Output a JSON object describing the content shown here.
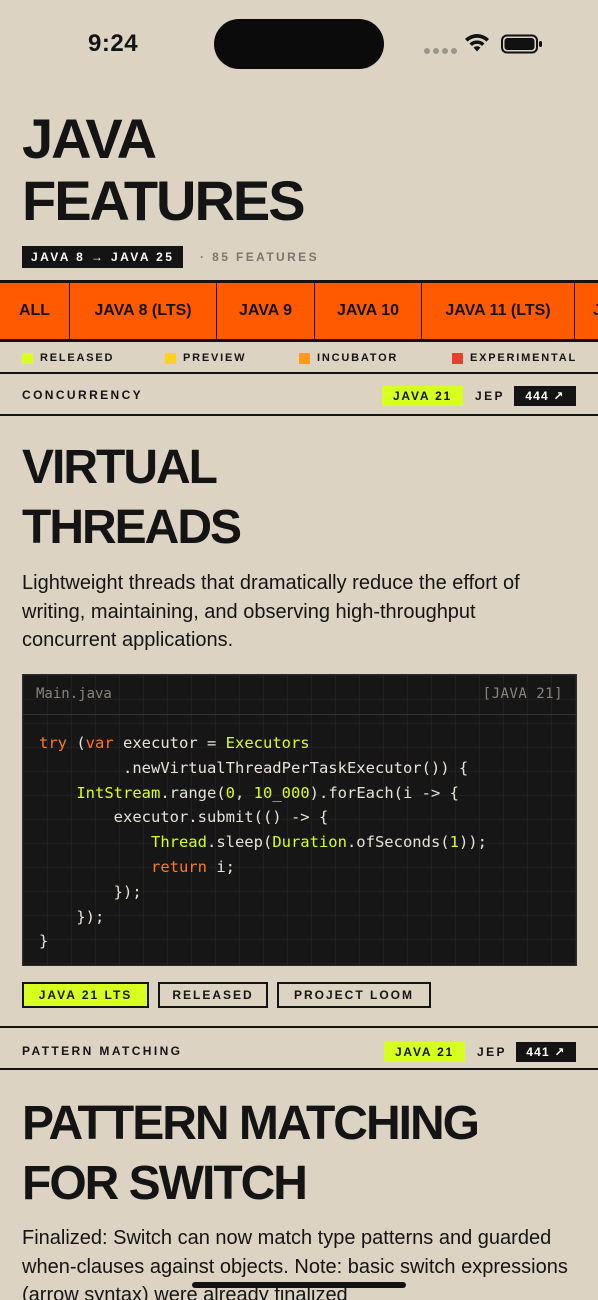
{
  "status": {
    "time": "9:24"
  },
  "header": {
    "title_line1": "JAVA",
    "title_line2": "FEATURES",
    "version_range": "JAVA 8 → JAVA 25",
    "feature_count": "· 85 FEATURES"
  },
  "tabs": [
    {
      "label": "ALL"
    },
    {
      "label": "JAVA 8 (LTS)"
    },
    {
      "label": "JAVA 9"
    },
    {
      "label": "JAVA 10"
    },
    {
      "label": "JAVA 11 (LTS)"
    },
    {
      "label": "J"
    }
  ],
  "legend": [
    {
      "label": "RELEASED",
      "color": "#d7ff1f"
    },
    {
      "label": "PREVIEW",
      "color": "#ffd21f"
    },
    {
      "label": "INCUBATOR",
      "color": "#ff9a1f"
    },
    {
      "label": "EXPERIMENTAL",
      "color": "#e8412b"
    }
  ],
  "features": [
    {
      "category": "CONCURRENCY",
      "java_version": "JAVA 21",
      "jep_label": "JEP",
      "jep_number": "444 ↗",
      "title_line1": "VIRTUAL",
      "title_line2": "THREADS",
      "description": "Lightweight threads that dramatically reduce the effort of writing, maintaining, and observing high-throughput concurrent applications.",
      "code": {
        "filename": "Main.java",
        "version_label": "[JAVA 21]"
      },
      "tags": [
        "JAVA 21 LTS",
        "RELEASED",
        "PROJECT LOOM"
      ]
    },
    {
      "category": "PATTERN MATCHING",
      "java_version": "JAVA 21",
      "jep_label": "JEP",
      "jep_number": "441 ↗",
      "title_line1": "PATTERN MATCHING",
      "title_line2": "FOR SWITCH",
      "description": "Finalized: Switch can now match type patterns and guarded when-clauses against objects. Note: basic switch expressions (arrow syntax) were already finalized"
    }
  ],
  "colors": {
    "background": "#dcd3c3",
    "accent_orange": "#ff5a00",
    "accent_lime": "#d7ff1f",
    "ink": "#141414"
  }
}
